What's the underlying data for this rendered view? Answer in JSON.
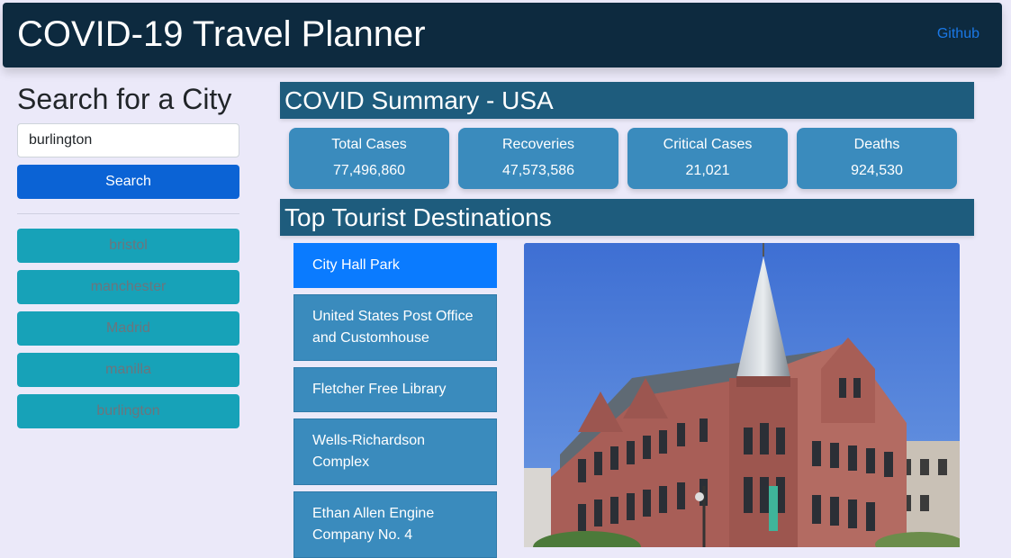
{
  "header": {
    "brand": "COVID-19 Travel Planner",
    "github_link": "Github"
  },
  "sidebar": {
    "title": "Search for a City",
    "search_value": "burlington",
    "search_button": "Search",
    "history": [
      "bristol",
      "manchester",
      "Madrid",
      "manilla",
      "burlington"
    ]
  },
  "summary": {
    "title": "COVID Summary - USA",
    "stats": [
      {
        "label": "Total Cases",
        "value": "77,496,860"
      },
      {
        "label": "Recoveries",
        "value": "47,573,586"
      },
      {
        "label": "Critical Cases",
        "value": "21,021"
      },
      {
        "label": "Deaths",
        "value": "924,530"
      }
    ]
  },
  "destinations": {
    "title": "Top Tourist Destinations",
    "items": [
      "City Hall Park",
      "United States Post Office and Customhouse",
      "Fletcher Free Library",
      "Wells-Richardson Complex",
      "Ethan Allen Engine Company No. 4"
    ],
    "active_index": 0
  },
  "colors": {
    "navbar": "#0d2a3f",
    "section_header": "#1e5c7d",
    "card": "#3a8bbd",
    "active": "#0a7bff",
    "history_button": "#17a2b8",
    "search_button": "#0b63d5"
  }
}
